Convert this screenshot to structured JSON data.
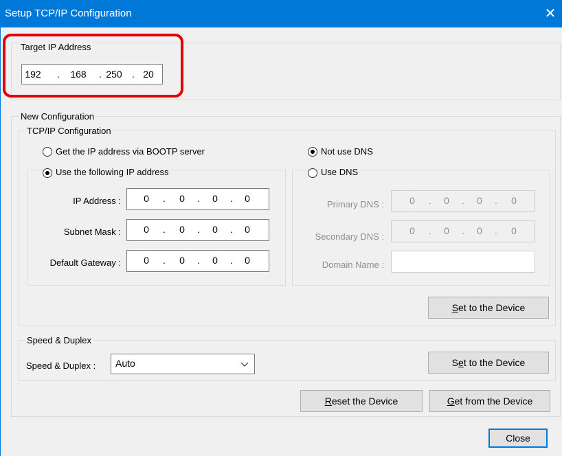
{
  "window": {
    "title": "Setup TCP/IP Configuration",
    "close_glyph": "✕"
  },
  "target": {
    "legend": "Target IP Address",
    "ip": [
      "192",
      "168",
      "250",
      "20"
    ]
  },
  "new_config": {
    "legend": "New Configuration",
    "tcpip": {
      "legend": "TCP/IP Configuration",
      "radio_bootp": {
        "label": "Get the IP address via BOOTP server",
        "selected": false
      },
      "radio_static": {
        "label": "Use the following IP address",
        "selected": true
      },
      "ip_address": {
        "label": "IP Address :",
        "value": [
          "0",
          "0",
          "0",
          "0"
        ]
      },
      "subnet_mask": {
        "label": "Subnet Mask :",
        "value": [
          "0",
          "0",
          "0",
          "0"
        ]
      },
      "gateway": {
        "label": "Default Gateway :",
        "value": [
          "0",
          "0",
          "0",
          "0"
        ]
      },
      "radio_no_dns": {
        "label": "Not use DNS",
        "selected": true
      },
      "radio_dns": {
        "label": "Use DNS",
        "selected": false
      },
      "primary_dns": {
        "label": "Primary DNS :",
        "value": [
          "0",
          "0",
          "0",
          "0"
        ]
      },
      "secondary_dns": {
        "label": "Secondary DNS :",
        "value": [
          "0",
          "0",
          "0",
          "0"
        ]
      },
      "domain_name": {
        "label": "Domain Name :",
        "value": ""
      },
      "set_button": {
        "mnemonic": "S",
        "rest": "et to the Device"
      }
    },
    "speed": {
      "legend": "Speed & Duplex",
      "label": "Speed & Duplex :",
      "selected": "Auto",
      "set_button": {
        "pre": "S",
        "mnemonic": "e",
        "rest": "t to the Device"
      }
    }
  },
  "buttons": {
    "reset": {
      "mnemonic": "R",
      "rest": "eset the Device"
    },
    "get": {
      "mnemonic": "G",
      "rest": "et from the Device"
    },
    "close": "Close"
  },
  "colors": {
    "accent": "#0078d7",
    "highlight": "#e00000",
    "face": "#f0f0f0"
  }
}
